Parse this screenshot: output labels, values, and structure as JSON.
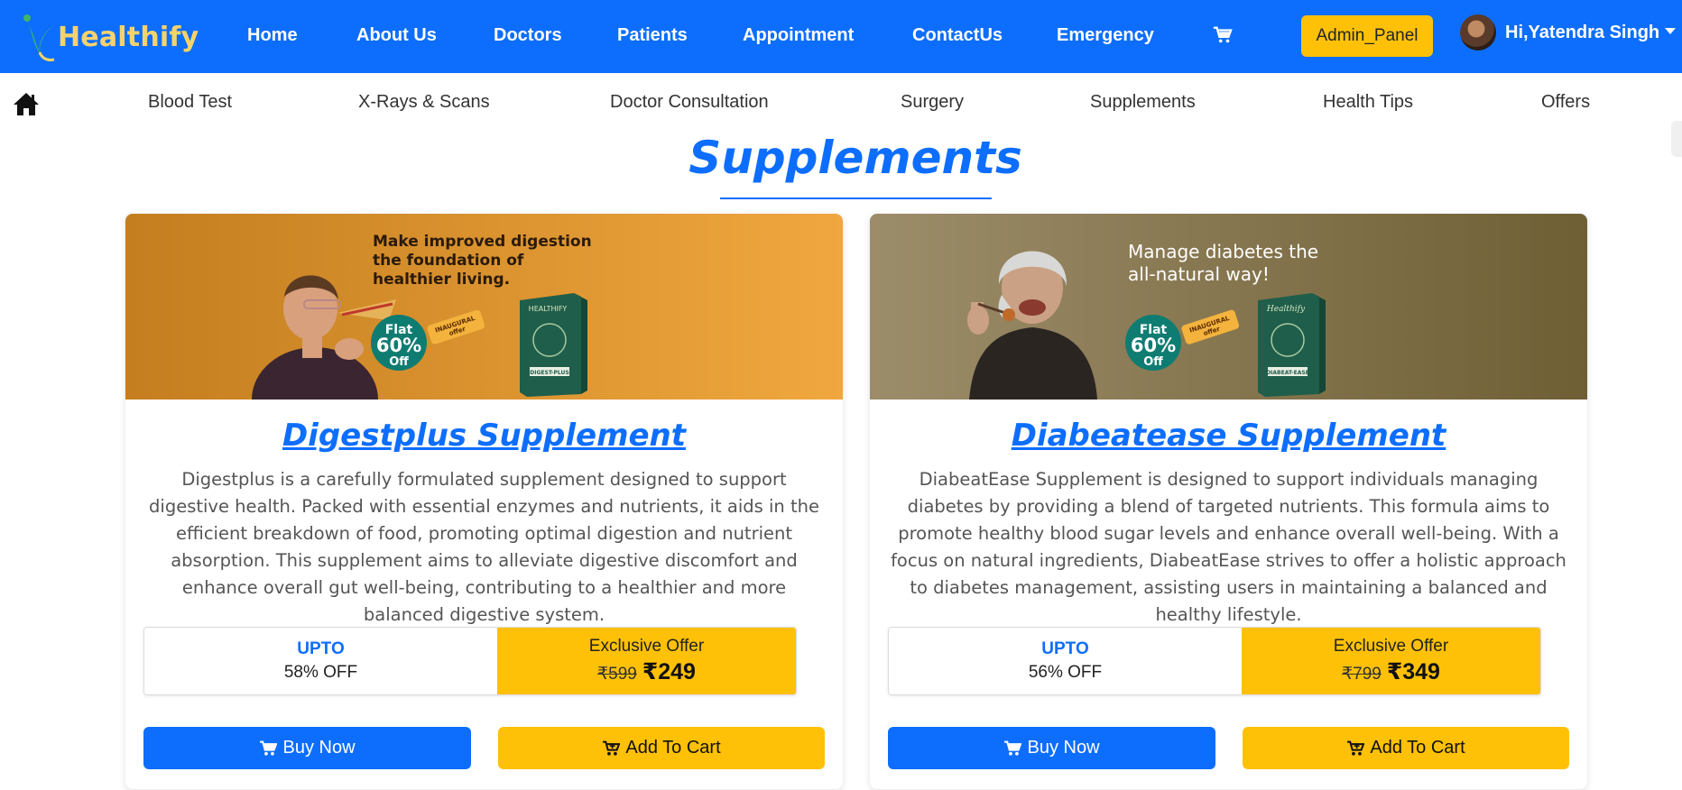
{
  "brand": {
    "name": "Healthify"
  },
  "nav": {
    "items": [
      {
        "label": "Home"
      },
      {
        "label": "About Us"
      },
      {
        "label": "Doctors"
      },
      {
        "label": "Patients"
      },
      {
        "label": "Appointment"
      },
      {
        "label": "ContactUs"
      },
      {
        "label": "Emergency"
      }
    ],
    "cart_icon": "cart-icon",
    "admin_label": "Admin_Panel",
    "user_greeting": "Hi,Yatendra Singh"
  },
  "subnav": {
    "home_icon": "home-icon",
    "items": [
      {
        "label": "Blood Test"
      },
      {
        "label": "X-Rays & Scans"
      },
      {
        "label": "Doctor Consultation"
      },
      {
        "label": "Surgery"
      },
      {
        "label": "Supplements"
      },
      {
        "label": "Health Tips"
      },
      {
        "label": "Offers"
      }
    ]
  },
  "page": {
    "title": "Supplements"
  },
  "products": [
    {
      "banner": {
        "headline": [
          "Make improved digestion",
          "the foundation of",
          "healthier living."
        ],
        "badge": [
          "Flat",
          "60%",
          "Off"
        ],
        "tag": [
          "INAUGURAL",
          "offer"
        ],
        "box_brand": "HEALTHIFY",
        "box_label": "DIGEST-PLUS",
        "colors": {
          "from": "#c47e1f",
          "to": "#f0a73f"
        }
      },
      "title": "Digestplus Supplement",
      "description": "Digestplus is a carefully formulated supplement designed to support digestive health. Packed with essential enzymes and nutrients, it aids in the efficient breakdown of food, promoting optimal digestion and nutrient absorption. This supplement aims to alleviate digestive discomfort and enhance overall gut well-being, contributing to a healthier and more balanced digestive system.",
      "upto": "UPTO",
      "discount": "58% OFF",
      "exclusive": "Exclusive Offer",
      "old_price": "₹599",
      "new_price": "₹249",
      "buy_label": "Buy Now",
      "cart_label": "Add To Cart"
    },
    {
      "banner": {
        "headline": [
          "Manage diabetes the",
          "all-natural way!"
        ],
        "badge": [
          "Flat",
          "60%",
          "Off"
        ],
        "tag": [
          "INAUGURAL",
          "offer"
        ],
        "box_brand": "Healthify",
        "box_label": "DIABEAT-EASE",
        "colors": {
          "from": "#9c8d6a",
          "to": "#6f5f35"
        }
      },
      "title": "Diabeatease Supplement",
      "description": "DiabeatEase Supplement is designed to support individuals managing diabetes by providing a blend of targeted nutrients. This formula aims to promote healthy blood sugar levels and enhance overall well-being. With a focus on natural ingredients, DiabeatEase strives to offer a holistic approach to diabetes management, assisting users in maintaining a balanced and healthy lifestyle.",
      "upto": "UPTO",
      "discount": "56% OFF",
      "exclusive": "Exclusive Offer",
      "old_price": "₹799",
      "new_price": "₹349",
      "buy_label": "Buy Now",
      "cart_label": "Add To Cart"
    }
  ],
  "colors": {
    "primary": "#0d6efd",
    "warning": "#ffc107",
    "brand_text": "#f5d36b"
  }
}
